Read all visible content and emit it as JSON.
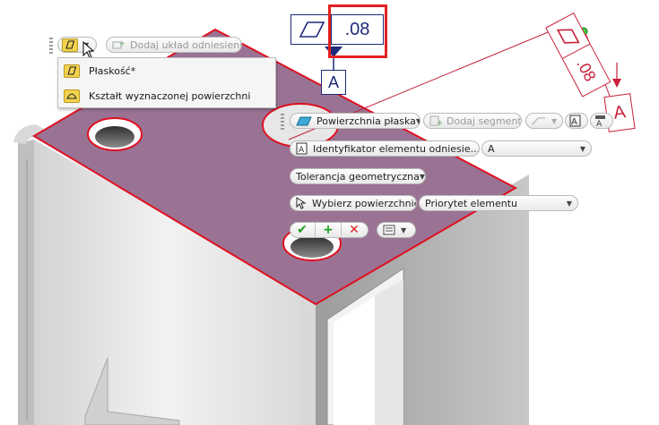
{
  "top_toolbar": {
    "add_datum_label": "Dodaj układ odniesienia"
  },
  "shape_menu": {
    "items": [
      {
        "label": "Płaskość*",
        "icon": "flatness-icon"
      },
      {
        "label": "Kształt wyznaczonej powierzchni",
        "icon": "profile-of-surface-icon"
      }
    ]
  },
  "fcf_annotation": {
    "tolerance": ".08",
    "datum": "A"
  },
  "fcf_annotation_right": {
    "tolerance": ".08",
    "datum": "A"
  },
  "mini_toolbar": {
    "surface_type": "Powierzchnia płaska",
    "add_segment": "Dodaj segment",
    "datum_identifier_label": "Identyfikator elementu odniesie...",
    "datum_identifier_value": "A",
    "geometric_tolerance_label": "Tolerancja geometryczna",
    "select_surfaces_label": "Wybierz powierzchnie",
    "priority_label": "Priorytet elementu"
  },
  "colors": {
    "face": "#9a7394",
    "highlight": "#e01020",
    "annotation_blue": "#1e2a7a",
    "annotation_red": "#c8203a",
    "accent_red_box": "#e22020"
  }
}
